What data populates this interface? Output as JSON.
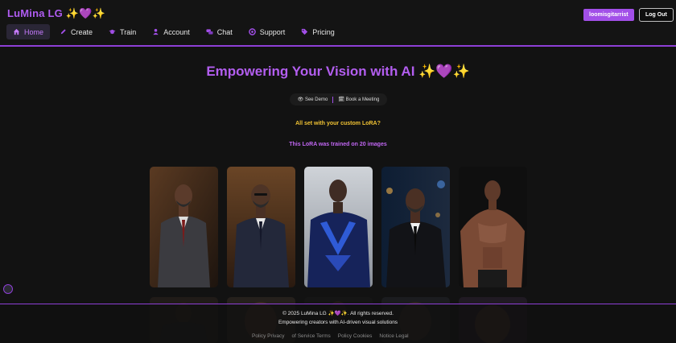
{
  "header": {
    "brand_name": "LuMina LG",
    "brand_spark_left": "✨",
    "brand_heart": "💜",
    "brand_spark_right": "✨",
    "user_button": "loomisgitarrist",
    "logout_button": "Log Out",
    "accent_color": "#a24fe8"
  },
  "nav": {
    "items": [
      {
        "label": "Home",
        "icon": "home-icon",
        "active": true
      },
      {
        "label": "Create",
        "icon": "pencil-icon"
      },
      {
        "label": "Train",
        "icon": "graduation-cap-icon"
      },
      {
        "label": "Account",
        "icon": "user-icon"
      },
      {
        "label": "Chat",
        "icon": "chat-bubbles-icon"
      },
      {
        "label": "Support",
        "icon": "lifebuoy-icon"
      },
      {
        "label": "Pricing",
        "icon": "tag-icon"
      }
    ]
  },
  "hero": {
    "title": "Empowering Your Vision with AI",
    "spark_left": "✨",
    "heart": "💜",
    "spark_right": "✨",
    "see_demo": "See Demo",
    "book_meeting": "Book a Meeting",
    "ready_text": "All set with your custom LoRA?",
    "trained_text": "This LoRA was trained on 20 images"
  },
  "gallery": {
    "images": [
      {
        "name": "man-in-grey-three-piece-suit"
      },
      {
        "name": "man-in-navy-suit-with-glasses"
      },
      {
        "name": "man-in-blue-superhero-suit"
      },
      {
        "name": "man-in-black-suit-city-lights"
      },
      {
        "name": "muscular-shirtless-man"
      }
    ]
  },
  "footer": {
    "copyright_prefix": "© 2025 LuMina LG",
    "spark_left": "✨",
    "heart": "💜",
    "spark_right": "✨",
    "copyright_suffix": ". All rights reserved.",
    "tagline": "Empowering creators with AI-driven visual solutions",
    "links": [
      "Policy Privacy",
      "of Service Terms",
      "Policy Cookies",
      "Notice Legal"
    ]
  }
}
